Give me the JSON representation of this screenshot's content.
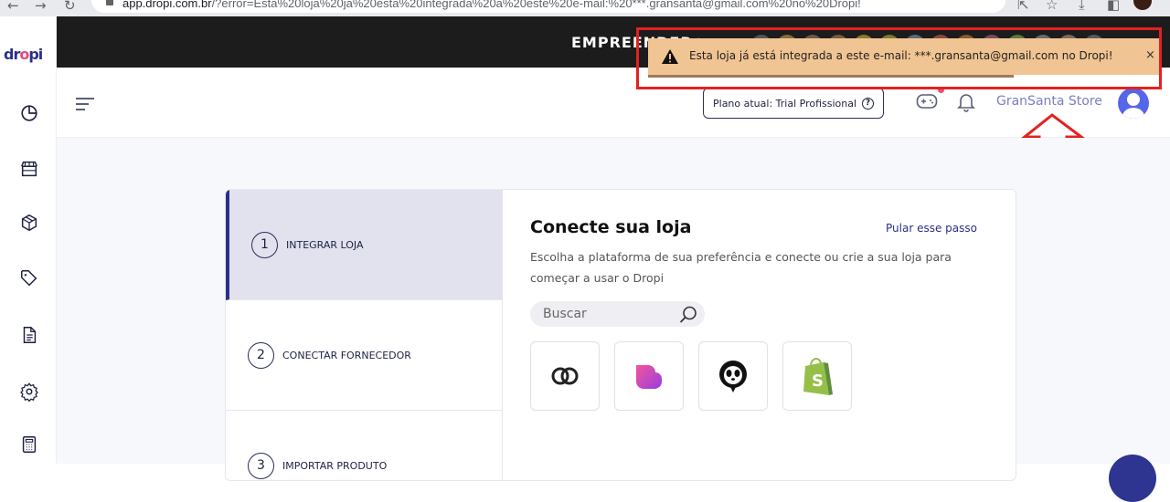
{
  "browser": {
    "url_host": "app.dropi.com.br",
    "url_path": "/?error=Esta%20loja%20ja%20esta%20integrada%20a%20este%20e-mail:%20***.gransanta@gmail.com%20no%20Dropi!"
  },
  "sidebar": {
    "logo": "dropi",
    "items": [
      {
        "icon": "pie-chart-icon"
      },
      {
        "icon": "store-icon"
      },
      {
        "icon": "box-icon"
      },
      {
        "icon": "tag-icon"
      },
      {
        "icon": "document-icon"
      },
      {
        "icon": "gear-icon"
      },
      {
        "icon": "calculator-icon"
      }
    ]
  },
  "banner": {
    "title": "EMPREENDER+"
  },
  "header": {
    "plan_label": "Plano atual: Trial Profissional",
    "store_name": "GranSanta Store"
  },
  "toast": {
    "message": "Esta loja já está integrada a este e-mail: ***.gransanta@gmail.com no Dropi!",
    "close": "×"
  },
  "steps": [
    {
      "num": "1",
      "label": "INTEGRAR LOJA",
      "active": true
    },
    {
      "num": "2",
      "label": "CONECTAR FORNECEDOR",
      "active": false
    },
    {
      "num": "3",
      "label": "IMPORTAR PRODUTO",
      "active": false
    }
  ],
  "content": {
    "title": "Conecte sua loja",
    "skip": "Pular esse passo",
    "description": "Escolha a plataforma de sua preferência e conecte ou crie a sua loja para começar a usar o Dropi",
    "search_placeholder": "Buscar",
    "platforms": [
      "link-icon",
      "heart-store-icon",
      "panda-icon",
      "shopify-icon"
    ]
  },
  "colors": {
    "brand": "#2a2f8a",
    "accent": "#e14b7a",
    "toast_bg": "#f0c493",
    "highlight_red": "#e52020"
  }
}
